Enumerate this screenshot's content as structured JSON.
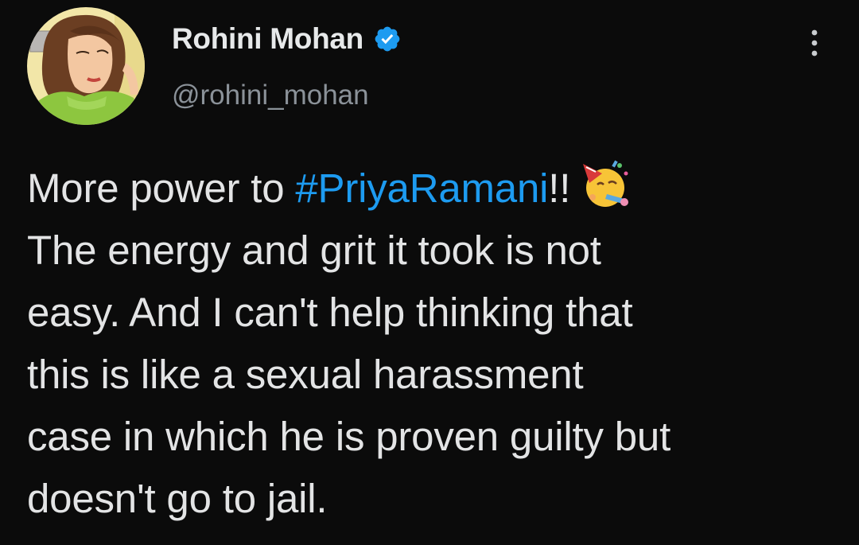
{
  "author": {
    "display_name": "Rohini Mohan",
    "handle": "@rohini_mohan",
    "verified": true,
    "avatar_icon": "illustrated-woman-avatar",
    "verified_icon": "verified-badge-icon"
  },
  "menu": {
    "more_icon": "more-options-icon"
  },
  "tweet": {
    "line1_prefix": "More power to ",
    "hashtag": "#PriyaRamani",
    "line1_suffix": "!!",
    "emoji": "partying-face-emoji",
    "line2": "The energy and grit it took is not",
    "line3": "easy. And I can't help thinking that",
    "line4": "this is like a sexual harassment",
    "line5": "case in which he is proven guilty but",
    "line6": "doesn't go to jail."
  },
  "colors": {
    "background": "#0b0b0b",
    "text": "#e7e9ea",
    "secondary_text": "#8b9299",
    "link": "#1d9bf0"
  }
}
